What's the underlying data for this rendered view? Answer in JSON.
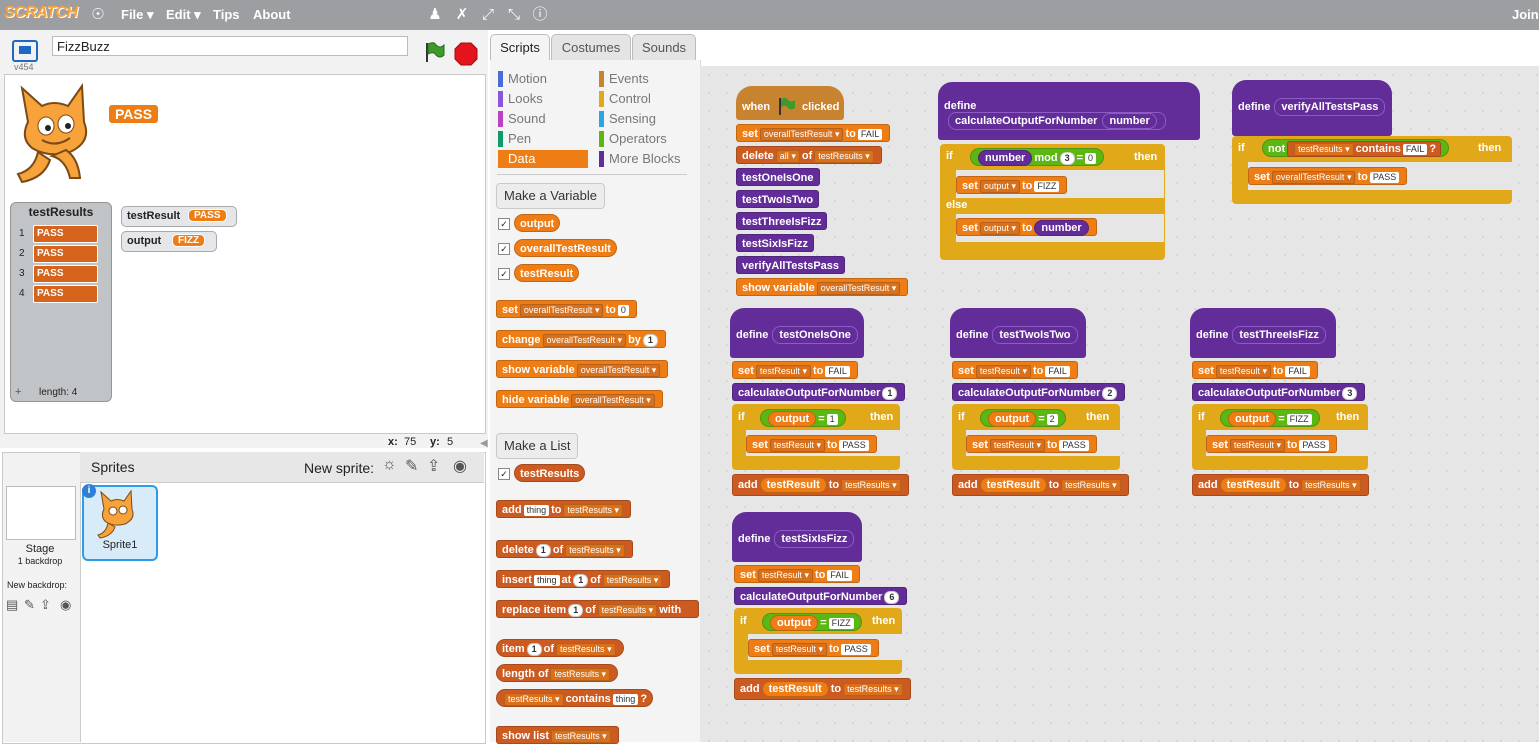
{
  "menubar": {
    "logo": "SCRATCH",
    "file": "File ▾",
    "edit": "Edit ▾",
    "tips": "Tips",
    "about": "About",
    "join": "Join"
  },
  "stage": {
    "project_title": "FizzBuzz",
    "version": "v454",
    "sprite_say": "PASS",
    "mouse_x_label": "x:",
    "mouse_x": "75",
    "mouse_y_label": "y:",
    "mouse_y": "5",
    "list_monitor": {
      "title": "testResults",
      "rows": [
        {
          "index": "1",
          "value": "PASS"
        },
        {
          "index": "2",
          "value": "PASS"
        },
        {
          "index": "3",
          "value": "PASS"
        },
        {
          "index": "4",
          "value": "PASS"
        }
      ],
      "add": "+",
      "length": "length: 4"
    },
    "var_monitors": [
      {
        "name": "testResult",
        "value": "PASS"
      },
      {
        "name": "output",
        "value": "FIZZ"
      }
    ]
  },
  "sprites": {
    "header": "Sprites",
    "new_sprite": "New sprite:",
    "stage_label": "Stage",
    "stage_sub": "1 backdrop",
    "new_backdrop": "New backdrop:",
    "sprite1": "Sprite1"
  },
  "tabs": [
    "Scripts",
    "Costumes",
    "Sounds"
  ],
  "palette": {
    "categories_left": [
      {
        "label": "Motion",
        "color": "#4a6cd4"
      },
      {
        "label": "Looks",
        "color": "#8a55d7"
      },
      {
        "label": "Sound",
        "color": "#bb42c3"
      },
      {
        "label": "Pen",
        "color": "#0e9a6c"
      },
      {
        "label": "Data",
        "color": "#ee7d16"
      }
    ],
    "categories_right": [
      {
        "label": "Events",
        "color": "#c88330"
      },
      {
        "label": "Control",
        "color": "#e1a91a"
      },
      {
        "label": "Sensing",
        "color": "#2ca5e2"
      },
      {
        "label": "Operators",
        "color": "#5cb712"
      },
      {
        "label": "More Blocks",
        "color": "#632d99"
      }
    ],
    "make_variable": "Make a Variable",
    "variables": [
      "output",
      "overallTestResult",
      "testResult"
    ],
    "set_label": "set",
    "set_var": "overallTestResult",
    "to_label": "to",
    "set_val": "0",
    "change_label": "change",
    "by_label": "by",
    "change_val": "1",
    "show_variable": "show variable",
    "hide_variable": "hide variable",
    "make_list": "Make a List",
    "list_name": "testResults",
    "add_label": "add",
    "thing": "thing",
    "delete_label": "delete",
    "of_label": "of",
    "one": "1",
    "insert_label": "insert",
    "at_label": "at",
    "replace_label": "replace",
    "item_label": "item",
    "with_label": "with",
    "length_label": "length",
    "contains_label": "contains",
    "q": "?",
    "show_list": "show list"
  },
  "scripts": {
    "when_flag": "when",
    "clicked": "clicked",
    "set": "set",
    "to": "to",
    "fail": "FAIL",
    "pass": "PASS",
    "fizz": "FIZZ",
    "overall": "overallTestResult",
    "delete": "delete",
    "all": "all",
    "of": "of",
    "list": "testResults",
    "calls": [
      "testOneIsOne",
      "testTwoIsTwo",
      "testThreeIsFizz",
      "testSixIsFizz",
      "verifyAllTestsPass"
    ],
    "show_variable": "show variable",
    "define": "define",
    "calc": "calculateOutputForNumber",
    "number": "number",
    "if": "if",
    "mod": "mod",
    "three": "3",
    "eq": "=",
    "zero": "0",
    "then": "then",
    "else": "else",
    "output": "output",
    "not": "not",
    "contains": "contains",
    "q": "?",
    "test_result": "testResult",
    "add": "add",
    "tests": [
      {
        "name": "testOneIsOne",
        "arg": "1",
        "expect": "1"
      },
      {
        "name": "testTwoIsTwo",
        "arg": "2",
        "expect": "2"
      },
      {
        "name": "testThreeIsFizz",
        "arg": "3",
        "expect": "FIZZ"
      },
      {
        "name": "testSixIsFizz",
        "arg": "6",
        "expect": "FIZZ"
      }
    ],
    "verify": "verifyAllTestsPass"
  }
}
